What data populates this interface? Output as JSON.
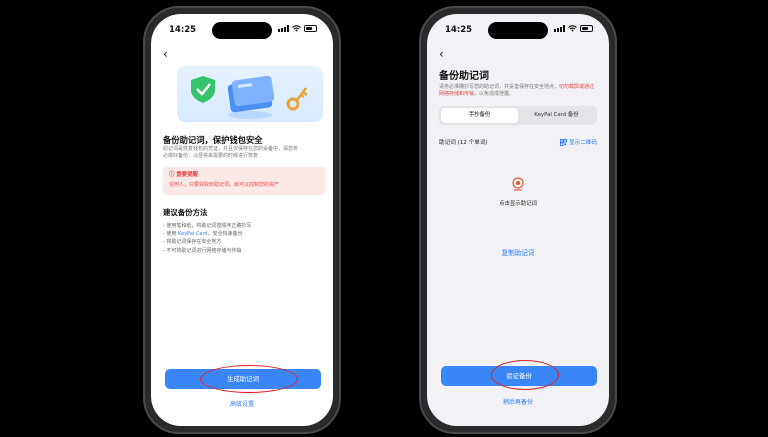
{
  "left": {
    "time": "14:25",
    "title": "备份助记词，保护钱包安全",
    "desc_lines": [
      "助记词是恢复钱包的凭证，并且仅保存在您的设备中，请您务",
      "必做好备份，以便将来需要的时候进行恢复"
    ],
    "warning_title": "重要提醒",
    "warning_text": "任何人，只要获取到助记词，就可以控制您的资产",
    "methods_title": "建议备份方法",
    "methods": [
      {
        "pre": "- 使用笔和纸，将助记词按顺序正确抄写",
        "hl": "",
        "post": ""
      },
      {
        "pre": "- 使用 ",
        "hl": "KeyPal Card",
        "post": "，安全快速备份"
      },
      {
        "pre": "- 将助记词保存在安全地方",
        "hl": "",
        "post": ""
      },
      {
        "pre": "- 不可将助记词进行网络存储与传输",
        "hl": "",
        "post": ""
      }
    ],
    "primary_button": "生成助记词",
    "secondary_link": "高级设置"
  },
  "right": {
    "time": "14:25",
    "title": "备份助记词",
    "desc_pre": "请务必准确抄写您的助记词，并妥善保存在安全地点，",
    "desc_red": "切勿截屏或通过网络存储和传输",
    "desc_post": "，以免造成泄露。",
    "tabs": [
      "手抄备份",
      "KeyPal Card 备份"
    ],
    "mnemonic_label": "助记词 (12 个单词)",
    "qr_link": "显示二维码",
    "reveal_text": "点击显示助记词",
    "copy_link": "复制助记词",
    "primary_button": "验证备份",
    "secondary_link": "稍后再备份"
  },
  "colors": {
    "accent": "#3a86f7",
    "link": "#2f7cf6",
    "warning": "#e24a4a",
    "highlight_ring": "#e02424"
  }
}
